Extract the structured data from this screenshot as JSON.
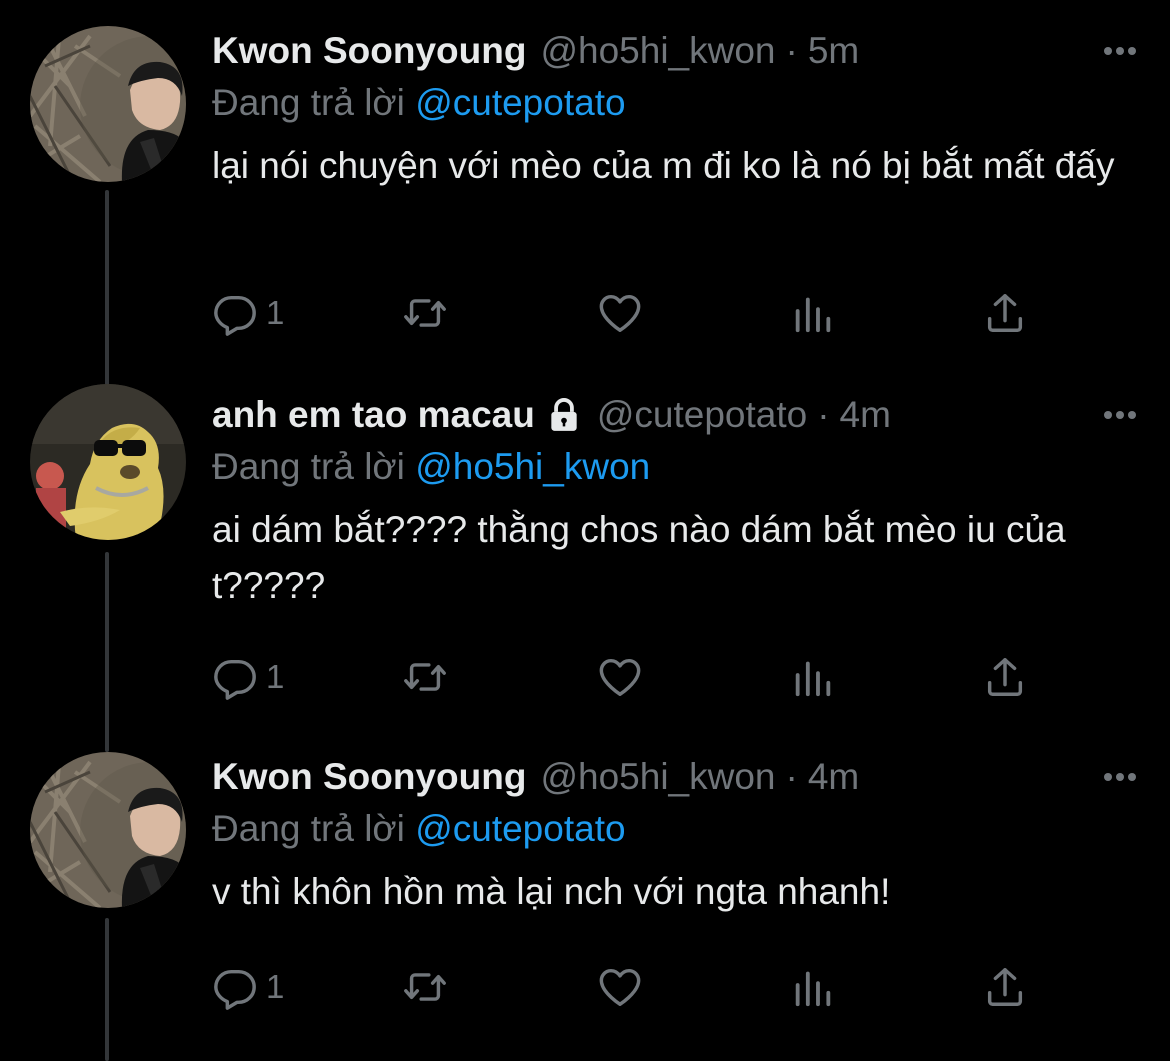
{
  "tweets": [
    {
      "display_name": "Kwon Soonyoung",
      "handle": "@ho5hi_kwon",
      "separator": "·",
      "time": "5m",
      "locked": false,
      "reply_prefix": "Đang trả lời",
      "reply_to": "@cutepotato",
      "text": "lại nói chuyện với mèo của m đi ko là nó bị bắt mất đấy",
      "reply_count": "1",
      "avatar": "person-photo"
    },
    {
      "display_name": "anh em tao macau",
      "handle": "@cutepotato",
      "separator": "·",
      "time": "4m",
      "locked": true,
      "reply_prefix": "Đang trả lời",
      "reply_to": "@ho5hi_kwon",
      "text": "ai dám bắt???? thằng chos nào dám bắt mèo iu của t?????",
      "reply_count": "1",
      "avatar": "dog-with-sunglasses"
    },
    {
      "display_name": "Kwon Soonyoung",
      "handle": "@ho5hi_kwon",
      "separator": "·",
      "time": "4m",
      "locked": false,
      "reply_prefix": "Đang trả lời",
      "reply_to": "@cutepotato",
      "text": "v thì khôn hồn mà lại nch với ngta nhanh!",
      "reply_count": "1",
      "avatar": "person-photo"
    }
  ],
  "colors": {
    "background": "#000000",
    "primary_text": "#e7e9ea",
    "secondary_text": "#71767b",
    "link": "#1d9bf0",
    "thread_line": "#333639"
  }
}
